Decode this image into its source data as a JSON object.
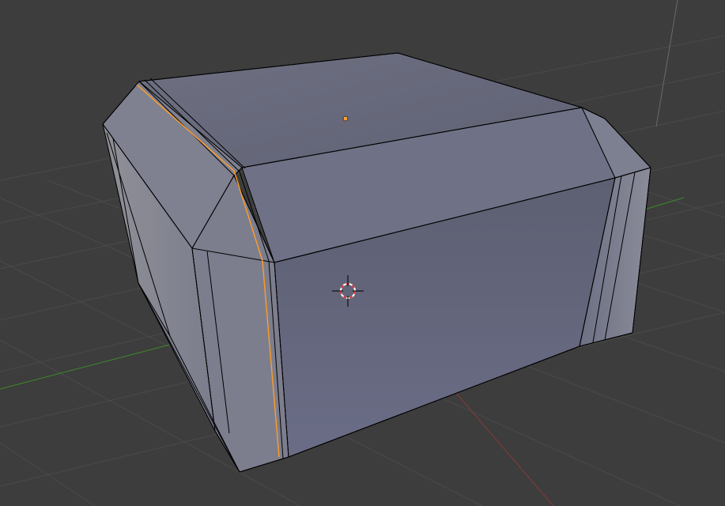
{
  "viewport": {
    "view": "3d-viewport",
    "background_color": "#3d3d3d",
    "grid_color": "#4a4a4a",
    "x_axis_color": "#8a3a3a",
    "y_axis_color": "#3d8a2a",
    "z_axis_color": "#6a6a6a"
  },
  "mesh": {
    "object_type": "beveled-cube",
    "face_color": "#6a6c80",
    "wire_color": "#000000",
    "selected_edge_color": "#ff9d26",
    "origin_color": "#ffa030"
  },
  "cursor": {
    "icon": "3d-cursor-icon",
    "ring_color_a": "#e03030",
    "ring_color_b": "#ffffff",
    "crosshair_color": "#000000"
  }
}
